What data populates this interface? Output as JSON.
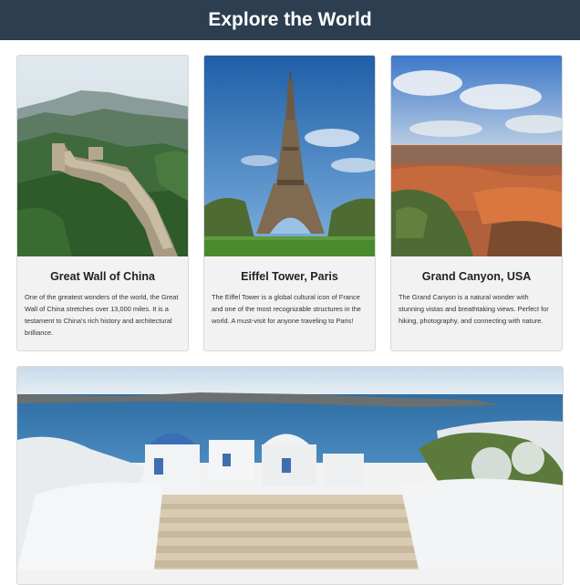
{
  "header": {
    "title": "Explore the World"
  },
  "cards": [
    {
      "title": "Great Wall of China",
      "description": "One of the greatest wonders of the world, the Great Wall of China stretches over 13,000 miles. It is a testament to China's rich history and architectural brilliance."
    },
    {
      "title": "Eiffel Tower, Paris",
      "description": "The Eiffel Tower is a global cultural icon of France and one of the most recognizable structures in the world. A must-visit for anyone traveling to Paris!"
    },
    {
      "title": "Grand Canyon, USA",
      "description": "The Grand Canyon is a natural wonder with stunning vistas and breathtaking views. Perfect for hiking, photography, and connecting with nature."
    }
  ],
  "colors": {
    "header_bg": "#2c3e50",
    "card_bg": "#f2f2f2",
    "card_border": "#d9d9d9"
  }
}
